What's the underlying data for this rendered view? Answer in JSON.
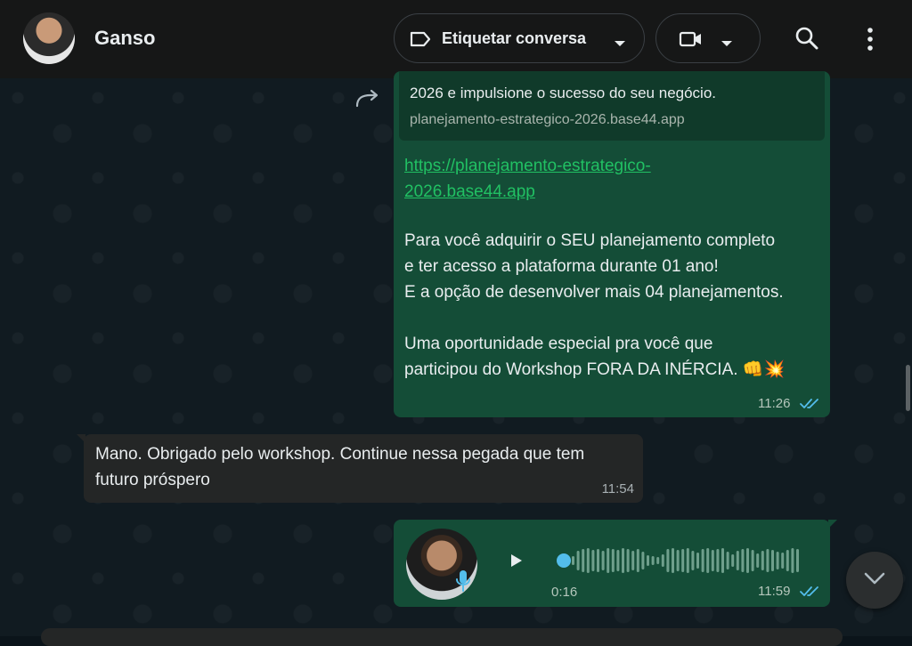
{
  "header": {
    "contact_name": "Ganso",
    "label_button": "Etiquetar conversa"
  },
  "messages": {
    "first": {
      "preview_description": "2026 e impulsione o sucesso do seu negócio.",
      "preview_url": "planejamento-estrategico-2026.base44.app",
      "link_line1": "https://planejamento-estrategico-",
      "link_line2": "2026.base44.app",
      "para1_line1": "Para você adquirir o SEU planejamento completo",
      "para1_line2": "e ter acesso a plataforma durante 01 ano!",
      "para1_line3": "E a opção de desenvolver mais 04 planejamentos.",
      "para2_line1": "Uma oportunidade especial pra você que",
      "para2_line2": "participou do Workshop FORA DA INÉRCIA. 👊💥",
      "time": "11:26"
    },
    "second": {
      "text": "Mano. Obrigado pelo workshop. Continue nessa pegada que tem futuro próspero",
      "time": "11:54"
    },
    "voice": {
      "duration": "0:16",
      "time": "11:59",
      "progress": 0
    }
  },
  "colors": {
    "outgoing_bubble": "#144d37",
    "incoming_bubble": "#242626",
    "link": "#21c063",
    "read_ticks": "#53bdeb"
  },
  "icons": [
    "label-icon",
    "chevron-down-icon",
    "video-camera-icon",
    "search-icon",
    "more-vertical-icon",
    "forward-icon",
    "double-check-icon",
    "play-icon",
    "microphone-icon",
    "chevron-down-icon"
  ]
}
